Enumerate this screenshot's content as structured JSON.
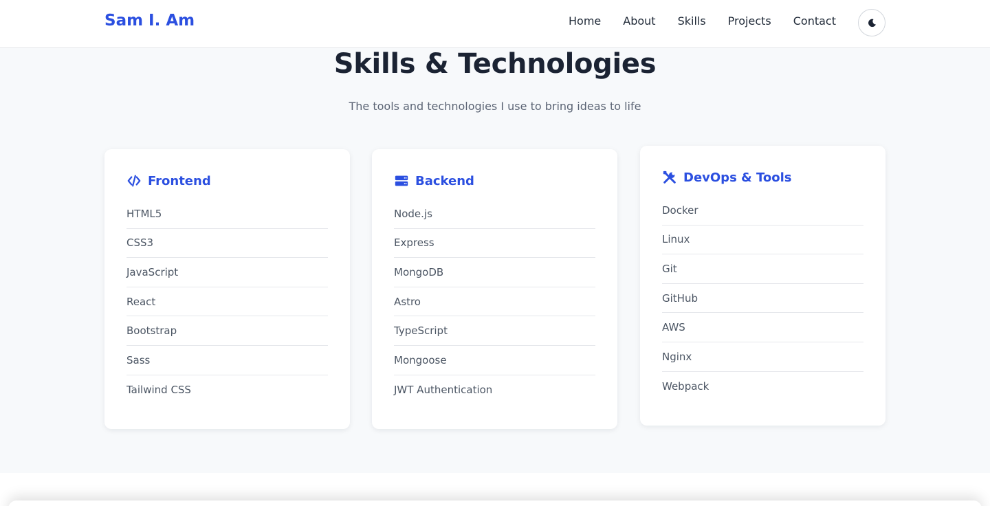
{
  "nav": {
    "brand": "Sam I. Am",
    "links": [
      "Home",
      "About",
      "Skills",
      "Projects",
      "Contact"
    ],
    "theme_icon": "moon-icon"
  },
  "section": {
    "title": "Skills & Technologies",
    "subtitle": "The tools and technologies I use to bring ideas to life"
  },
  "colors": {
    "accent": "#2b4fe0",
    "heading": "#1b2333",
    "background": "#f7f9fb"
  },
  "categories": [
    {
      "title": "Frontend",
      "icon": "code-icon",
      "skills": [
        "HTML5",
        "CSS3",
        "JavaScript",
        "React",
        "Bootstrap",
        "Sass",
        "Tailwind CSS"
      ]
    },
    {
      "title": "Backend",
      "icon": "server-icon",
      "skills": [
        "Node.js",
        "Express",
        "MongoDB",
        "Astro",
        "TypeScript",
        "Mongoose",
        "JWT Authentication"
      ]
    },
    {
      "title": "DevOps & Tools",
      "icon": "tools-icon",
      "skills": [
        "Docker",
        "Linux",
        "Git",
        "GitHub",
        "AWS",
        "Nginx",
        "Webpack"
      ]
    }
  ]
}
